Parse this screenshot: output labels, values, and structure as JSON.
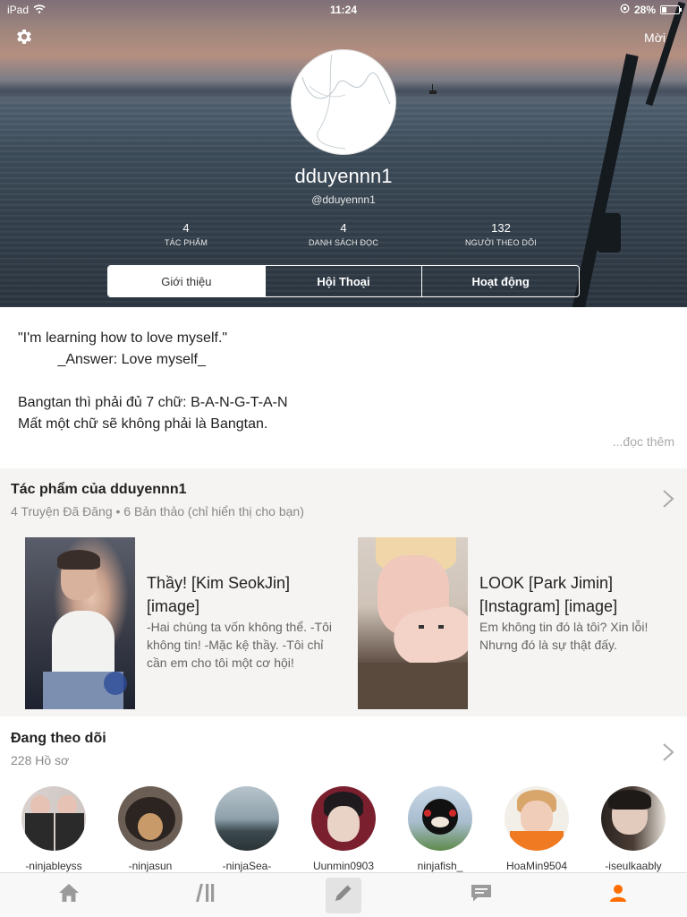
{
  "status_bar": {
    "device": "iPad",
    "time": "11:24",
    "battery": "28%"
  },
  "header": {
    "invite_label": "Mời",
    "display_name": "dduyennn1",
    "username": "@dduyennn1",
    "stats": [
      {
        "value": "4",
        "label": "TÁC PHẨM"
      },
      {
        "value": "4",
        "label": "DANH SÁCH ĐỌC"
      },
      {
        "value": "132",
        "label": "NGƯỜI THEO DÕI"
      }
    ],
    "tabs": [
      {
        "label": "Giới thiệu",
        "active": true
      },
      {
        "label": "Hội Thoại",
        "active": false
      },
      {
        "label": "Hoạt động",
        "active": false
      }
    ]
  },
  "about": {
    "lines": [
      "\"I'm learning how to love myself.\"",
      "          _Answer: Love myself_",
      "",
      "Bangtan thì phải đủ 7 chữ: B-A-N-G-T-A-N",
      "Mất một chữ sẽ không phải là Bangtan."
    ],
    "read_more": "...đọc thêm"
  },
  "works": {
    "title": "Tác phẩm của dduyennn1",
    "subtitle": "4 Truyện Đã Đăng • 6 Bản thảo (chỉ hiển thị cho bạn)",
    "stories": [
      {
        "title": "Thầy! [Kim SeokJin] [image]",
        "description": "-Hai chúng ta vốn không thể. -Tôi không tin! -Mặc kệ thầy. -Tôi chỉ cần em cho tôi một cơ hội!"
      },
      {
        "title": "LOOK [Park Jimin] [Instagram] [image]",
        "description": "Em không tin đó là tôi? Xin lỗi! Nhưng đó là sự thật đấy."
      }
    ]
  },
  "following": {
    "title": "Đang theo dõi",
    "subtitle": "228 Hồ sơ",
    "people": [
      {
        "name": "-ninjableyss"
      },
      {
        "name": "-ninjasun"
      },
      {
        "name": "-ninjaSea-"
      },
      {
        "name": "Uunmin0903"
      },
      {
        "name": "ninjafish_"
      },
      {
        "name": "HoaMin9504"
      },
      {
        "name": "-iseulkaably"
      }
    ]
  },
  "bottom_nav": {
    "items": [
      {
        "icon": "home-icon"
      },
      {
        "icon": "library-icon"
      },
      {
        "icon": "pencil-icon"
      },
      {
        "icon": "chat-icon"
      },
      {
        "icon": "profile-icon",
        "active": true
      }
    ]
  },
  "colors": {
    "accent": "#ff6d00",
    "nav_icon": "#9a9a9a"
  }
}
